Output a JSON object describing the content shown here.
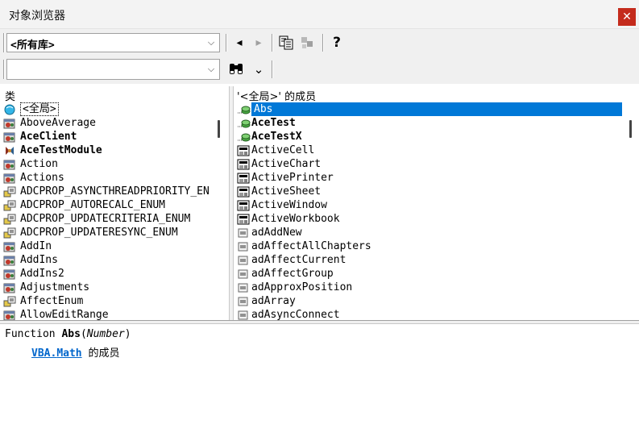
{
  "window": {
    "title": "对象浏览器",
    "close_glyph": "✕"
  },
  "toolbar": {
    "library_combo_value": "<所有库>",
    "search_combo_value": "",
    "dropdown_glyph": "⌵",
    "back_glyph": "◂",
    "forward_glyph": "▸",
    "help_glyph": "?",
    "find_glyph": "⌄"
  },
  "classes_pane": {
    "header": "类",
    "items": [
      {
        "label": "<全局>",
        "icon": "globe-icon",
        "bold": false
      },
      {
        "label": "AboveAverage",
        "icon": "class-icon",
        "bold": false
      },
      {
        "label": "AceClient",
        "icon": "class-icon",
        "bold": true
      },
      {
        "label": "AceTestModule",
        "icon": "module-icon",
        "bold": true
      },
      {
        "label": "Action",
        "icon": "class-icon",
        "bold": false
      },
      {
        "label": "Actions",
        "icon": "class-icon",
        "bold": false
      },
      {
        "label": "ADCPROP_ASYNCTHREADPRIORITY_EN",
        "icon": "enum-icon",
        "bold": false
      },
      {
        "label": "ADCPROP_AUTORECALC_ENUM",
        "icon": "enum-icon",
        "bold": false
      },
      {
        "label": "ADCPROP_UPDATECRITERIA_ENUM",
        "icon": "enum-icon",
        "bold": false
      },
      {
        "label": "ADCPROP_UPDATERESYNC_ENUM",
        "icon": "enum-icon",
        "bold": false
      },
      {
        "label": "AddIn",
        "icon": "class-icon",
        "bold": false
      },
      {
        "label": "AddIns",
        "icon": "class-icon",
        "bold": false
      },
      {
        "label": "AddIns2",
        "icon": "class-icon",
        "bold": false
      },
      {
        "label": "Adjustments",
        "icon": "class-icon",
        "bold": false
      },
      {
        "label": "AffectEnum",
        "icon": "enum-icon",
        "bold": false
      },
      {
        "label": "AllowEditRange",
        "icon": "class-icon",
        "bold": false
      }
    ]
  },
  "members_pane": {
    "header": "'<全局>' 的成员",
    "items": [
      {
        "label": "Abs",
        "icon": "method-icon",
        "bold": false
      },
      {
        "label": "AceTest",
        "icon": "method-icon",
        "bold": true
      },
      {
        "label": "AceTestX",
        "icon": "method-icon",
        "bold": true
      },
      {
        "label": "ActiveCell",
        "icon": "property-icon",
        "bold": false
      },
      {
        "label": "ActiveChart",
        "icon": "property-icon",
        "bold": false
      },
      {
        "label": "ActivePrinter",
        "icon": "property-icon",
        "bold": false
      },
      {
        "label": "ActiveSheet",
        "icon": "property-icon",
        "bold": false
      },
      {
        "label": "ActiveWindow",
        "icon": "property-icon",
        "bold": false
      },
      {
        "label": "ActiveWorkbook",
        "icon": "property-icon",
        "bold": false
      },
      {
        "label": "adAddNew",
        "icon": "constant-icon",
        "bold": false
      },
      {
        "label": "adAffectAllChapters",
        "icon": "constant-icon",
        "bold": false
      },
      {
        "label": "adAffectCurrent",
        "icon": "constant-icon",
        "bold": false
      },
      {
        "label": "adAffectGroup",
        "icon": "constant-icon",
        "bold": false
      },
      {
        "label": "adApproxPosition",
        "icon": "constant-icon",
        "bold": false
      },
      {
        "label": "adArray",
        "icon": "constant-icon",
        "bold": false
      },
      {
        "label": "adAsyncConnect",
        "icon": "constant-icon",
        "bold": false
      }
    ]
  },
  "details": {
    "keyword": "Function ",
    "name": "Abs",
    "open_paren": "(",
    "param": "Number",
    "close_paren": ")",
    "library_link": "VBA",
    "dot": ".",
    "module_link": "Math",
    "member_of": " 的成员"
  },
  "colors": {
    "selection": "#0078d7",
    "link": "#0066cc",
    "close": "#c42b1c"
  }
}
